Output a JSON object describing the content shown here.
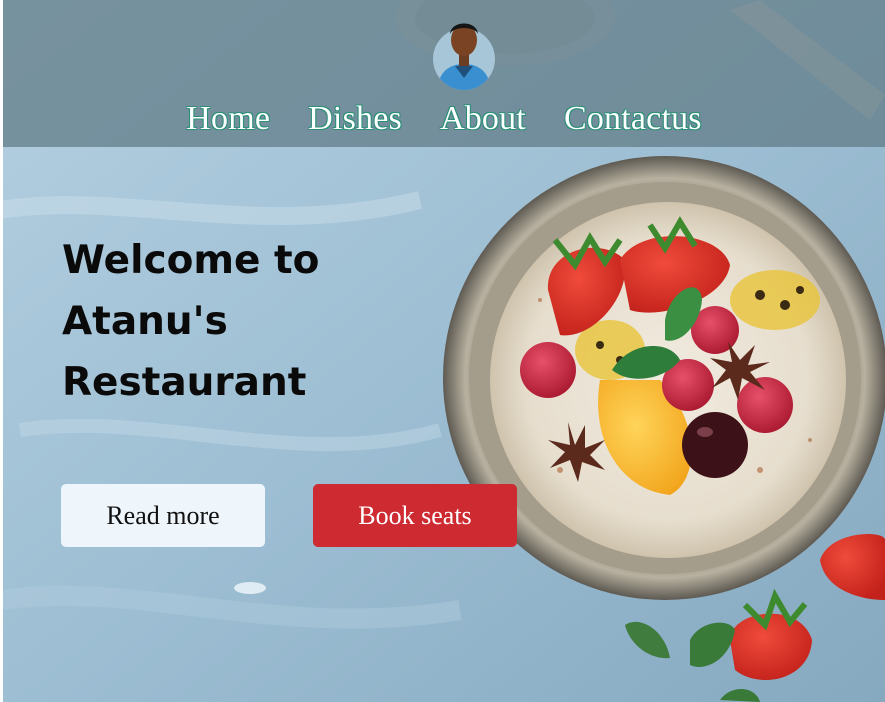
{
  "navbar": {
    "avatar_icon": "profile-photo",
    "items": [
      {
        "label": "Home"
      },
      {
        "label": "Dishes"
      },
      {
        "label": "About"
      },
      {
        "label": "Contactus"
      }
    ]
  },
  "hero": {
    "title_lines": [
      "Welcome to",
      "Atanu's",
      "Restaurant"
    ],
    "read_more_label": "Read more",
    "book_seats_label": "Book seats"
  },
  "colors": {
    "nav_overlay": "#607a85",
    "nav_text_outline": "#2b8f78",
    "read_more_bg": "#eef6fc",
    "book_seats_bg": "#cd2b31",
    "background": "#9fc1d6"
  }
}
